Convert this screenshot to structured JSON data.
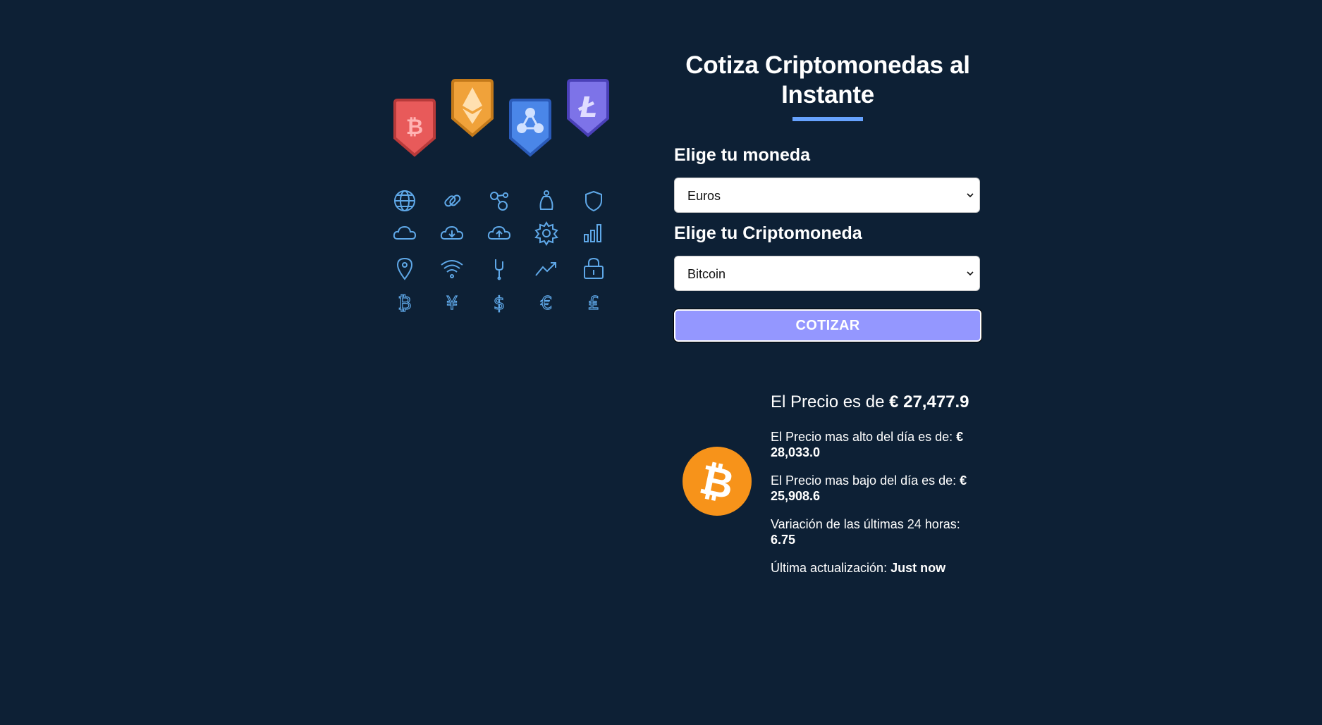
{
  "title": "Cotiza Criptomonedas al Instante",
  "form": {
    "currency_label": "Elige tu moneda",
    "currency_selected": "Euros",
    "crypto_label": "Elige tu Criptomoneda",
    "crypto_selected": "Bitcoin",
    "submit_label": "COTIZAR"
  },
  "result": {
    "price_prefix": "El Precio es de",
    "price_value": "€ 27,477.9",
    "high_label": "El Precio mas alto del día es de:",
    "high_value": "€ 28,033.0",
    "low_label": "El Precio mas bajo del día es de:",
    "low_value": "€ 25,908.6",
    "change_label": "Variación de las últimas 24 horas:",
    "change_value": "6.75",
    "updated_label": "Última actualización:",
    "updated_value": "Just now"
  },
  "icons": {
    "badges": [
      "bitcoin-badge-icon",
      "ethereum-badge-icon",
      "ripple-badge-icon",
      "litecoin-badge-icon"
    ],
    "grid": [
      "globe-icon",
      "link-icon",
      "nodes-icon",
      "money-bag-icon",
      "shield-icon",
      "cloud-icon",
      "cloud-download-icon",
      "cloud-upload-icon",
      "gear-icon",
      "bar-chart-icon",
      "location-pin-icon",
      "wifi-icon",
      "fork-icon",
      "trend-up-icon",
      "lock-icon",
      "bitcoin-icon",
      "yen-icon",
      "dollar-icon",
      "euro-icon",
      "pound-icon"
    ],
    "result_coin": "bitcoin-coin-icon"
  },
  "colors": {
    "background": "#0d2035",
    "accent": "#66a2fe",
    "button": "#9497ff",
    "bitcoin_orange": "#f7931a",
    "badge_red": "#e85a5a",
    "badge_orange": "#f0a23a",
    "badge_blue": "#4a86e8",
    "badge_purple": "#7d73e8",
    "icon_line": "#5fa8e8"
  }
}
